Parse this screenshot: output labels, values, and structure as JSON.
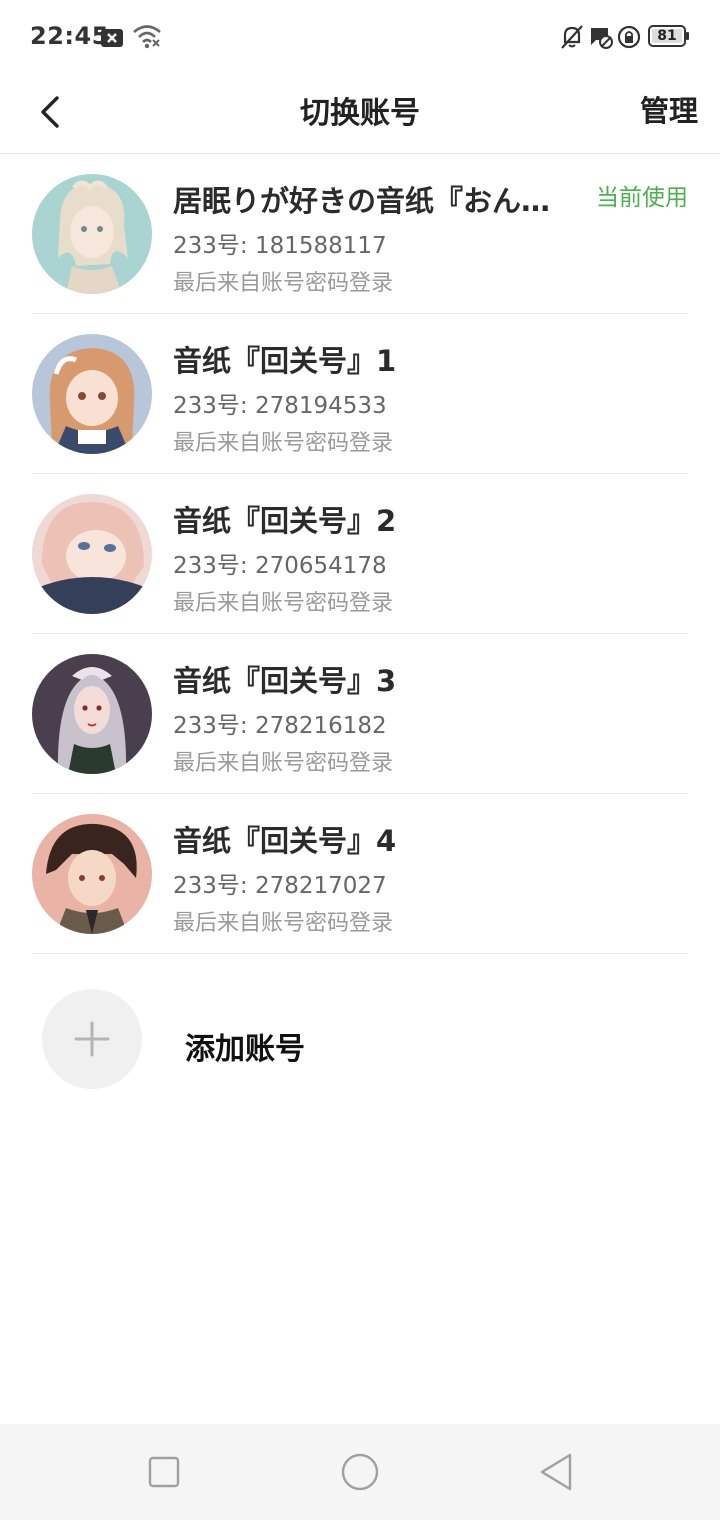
{
  "status_bar": {
    "time": "22:45",
    "battery": "81",
    "icons_left": [
      "close-box-icon",
      "wifi-icon"
    ],
    "icons_right": [
      "bell-off-icon",
      "message-blocked-icon",
      "lock-rotation-icon",
      "battery-icon"
    ]
  },
  "header": {
    "title": "切换账号",
    "manage_label": "管理",
    "back_icon": "chevron-left-icon"
  },
  "accounts": [
    {
      "name": "居眠りが好きの音纸『おんぷ』",
      "uid": "233号: 181588117",
      "login": "最后来自账号密码登录",
      "current": "当前使用"
    },
    {
      "name": "音纸『回关号』1",
      "uid": "233号: 278194533",
      "login": "最后来自账号密码登录",
      "current": ""
    },
    {
      "name": "音纸『回关号』2",
      "uid": "233号: 270654178",
      "login": "最后来自账号密码登录",
      "current": ""
    },
    {
      "name": "音纸『回关号』3",
      "uid": "233号: 278216182",
      "login": "最后来自账号密码登录",
      "current": ""
    },
    {
      "name": "音纸『回关号』4",
      "uid": "233号: 278217027",
      "login": "最后来自账号密码登录",
      "current": ""
    }
  ],
  "add_account": {
    "label": "添加账号",
    "icon": "plus-icon"
  },
  "nav_bar": {
    "icons": [
      "recents-square-icon",
      "home-circle-icon",
      "back-triangle-icon"
    ]
  },
  "colors": {
    "accent_green": "#4caf50",
    "divider": "#ececec",
    "secondary_text": "#666666",
    "tertiary_text": "#9a9a9a"
  }
}
